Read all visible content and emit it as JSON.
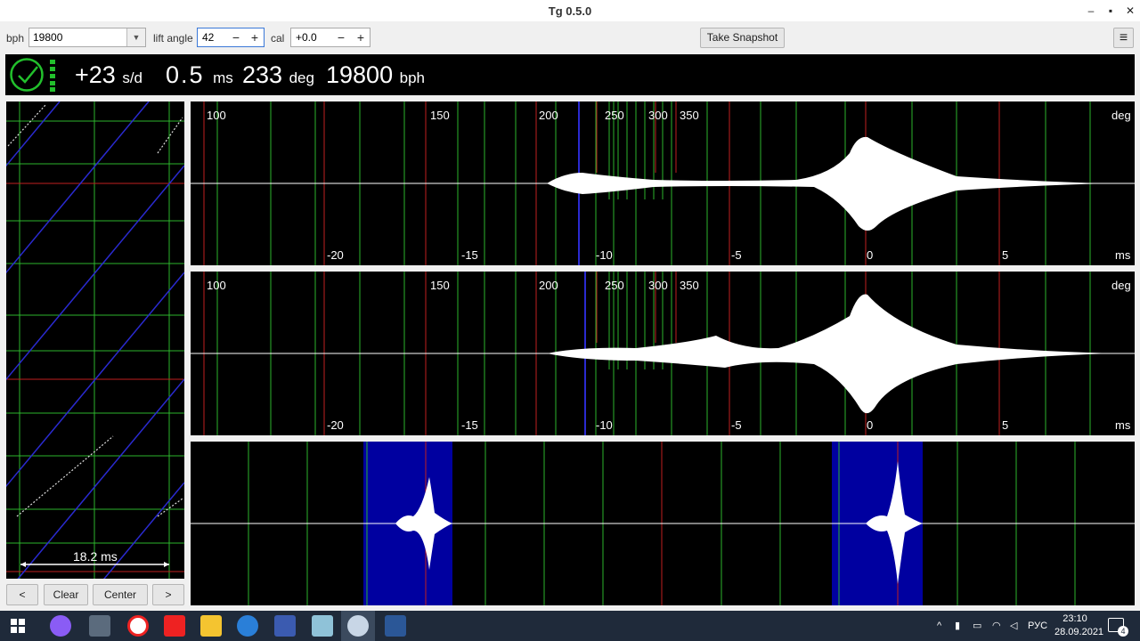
{
  "window": {
    "title": "Tg 0.5.0",
    "minimize": "–",
    "maximize": "▪",
    "close": "✕"
  },
  "toolbar": {
    "bph_label": "bph",
    "bph_value": "19800",
    "lift_angle_label": "lift angle",
    "lift_angle_value": "42",
    "cal_label": "cal",
    "cal_value": "+0.0",
    "minus": "−",
    "plus": "+",
    "snapshot_label": "Take Snapshot",
    "menu_icon": "hamburger-icon",
    "menu_glyph": "≡"
  },
  "status": {
    "rate": "+23",
    "rate_unit": "s/d",
    "beat_error": "0.5",
    "beat_error_unit": "ms",
    "amplitude": "233",
    "amplitude_unit": "deg",
    "bph": "19800",
    "bph_unit": "bph",
    "status_icon": "check-icon",
    "colors": {
      "ok": "#22c02c",
      "background": "#000000"
    }
  },
  "paperstrip": {
    "scale_label": "18.2 ms",
    "buttons": {
      "left": "<",
      "clear": "Clear",
      "center": "Center",
      "right": ">"
    }
  },
  "waveform_top": {
    "deg_labels": [
      "100",
      "150",
      "200",
      "250",
      "300",
      "350"
    ],
    "deg_unit": "deg",
    "ms_labels": [
      "-20",
      "-15",
      "-10",
      "-5",
      "0",
      "5"
    ],
    "ms_unit": "ms"
  },
  "waveform_mid": {
    "deg_labels": [
      "100",
      "150",
      "200",
      "250",
      "300",
      "350"
    ],
    "deg_unit": "deg",
    "ms_labels": [
      "-20",
      "-15",
      "-10",
      "-5",
      "0",
      "5"
    ],
    "ms_unit": "ms"
  },
  "taskbar": {
    "language": "РУС",
    "time": "23:10",
    "date": "28.09.2021",
    "notifications": "4",
    "icons": [
      "windows-start-icon",
      "alice-icon",
      "calculator-icon",
      "yandex-browser-icon",
      "yandex-icon",
      "file-explorer-icon",
      "outlook-icon",
      "save-app-icon",
      "notes-icon",
      "tg-timegrapher-icon",
      "word-icon"
    ]
  }
}
